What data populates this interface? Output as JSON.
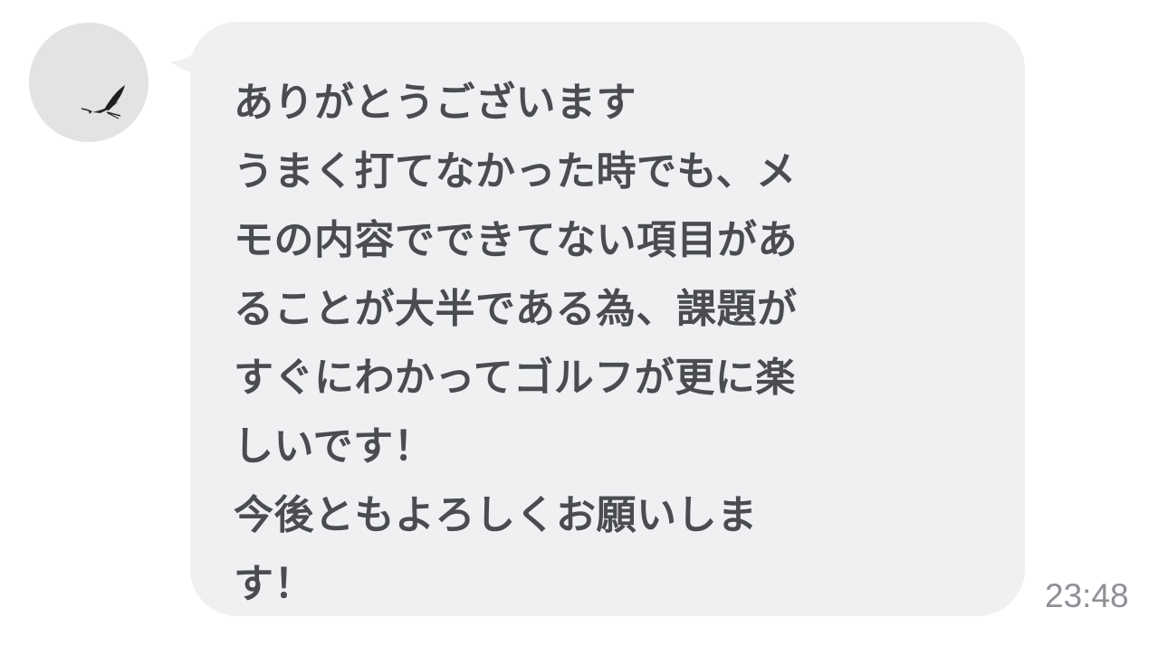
{
  "message": {
    "lines": [
      "ありがとうございます",
      "うまく打てなかった時でも、メ",
      "モの内容でできてない項目があ",
      "ることが大半である為、課題が",
      "すぐにわかってゴルフが更に楽",
      "しいです！",
      "今後ともよろしくお願いしま",
      "す！"
    ],
    "timestamp": "23:48"
  },
  "colors": {
    "bubble_background": "#eff0f2",
    "message_text": "#4a4c52",
    "timestamp_text": "#8e9096",
    "avatar_background": "#e3e3e5"
  },
  "icons": {
    "avatar": "bird-icon"
  }
}
